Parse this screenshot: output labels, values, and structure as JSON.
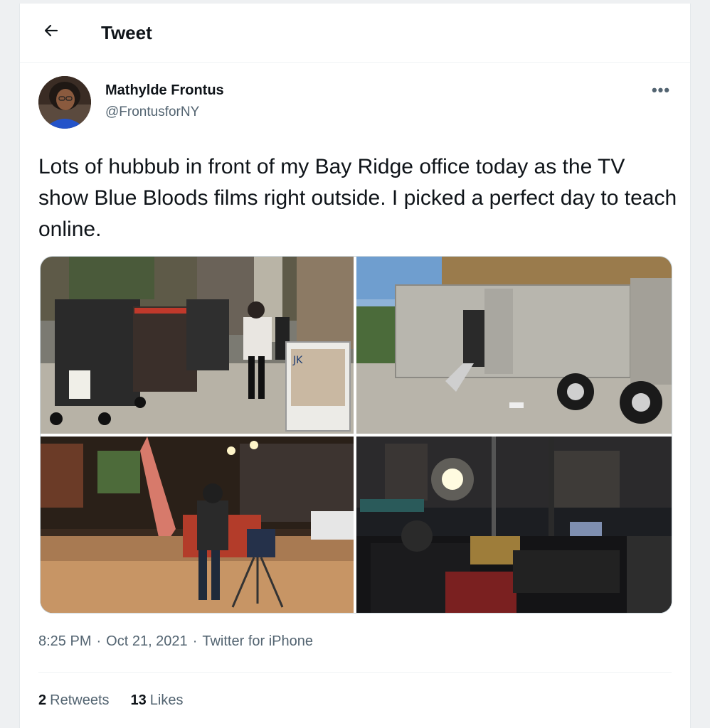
{
  "header": {
    "title": "Tweet",
    "back_icon": "arrow-left-icon"
  },
  "tweet": {
    "author": {
      "display_name": "Mathylde Frontus",
      "handle": "@FrontusforNY"
    },
    "more_icon": "more-horizontal-icon",
    "more_glyph": "•••",
    "text": "Lots of hubbub in front of my Bay Ridge office today as the TV show Blue Bloods films right outside. I picked a perfect day to teach online.",
    "media": [
      {
        "label": "photo-1"
      },
      {
        "label": "photo-2"
      },
      {
        "label": "photo-3"
      },
      {
        "label": "photo-4"
      }
    ],
    "sign_text": "JK",
    "time": "8:25 PM",
    "date": "Oct 21, 2021",
    "separator": "·",
    "source": "Twitter for iPhone",
    "stats": {
      "retweets_count": "2",
      "retweets_label": "Retweets",
      "likes_count": "13",
      "likes_label": "Likes"
    }
  },
  "colors": {
    "text_primary": "#0f1419",
    "text_secondary": "#536471",
    "border": "#eff3f4"
  }
}
